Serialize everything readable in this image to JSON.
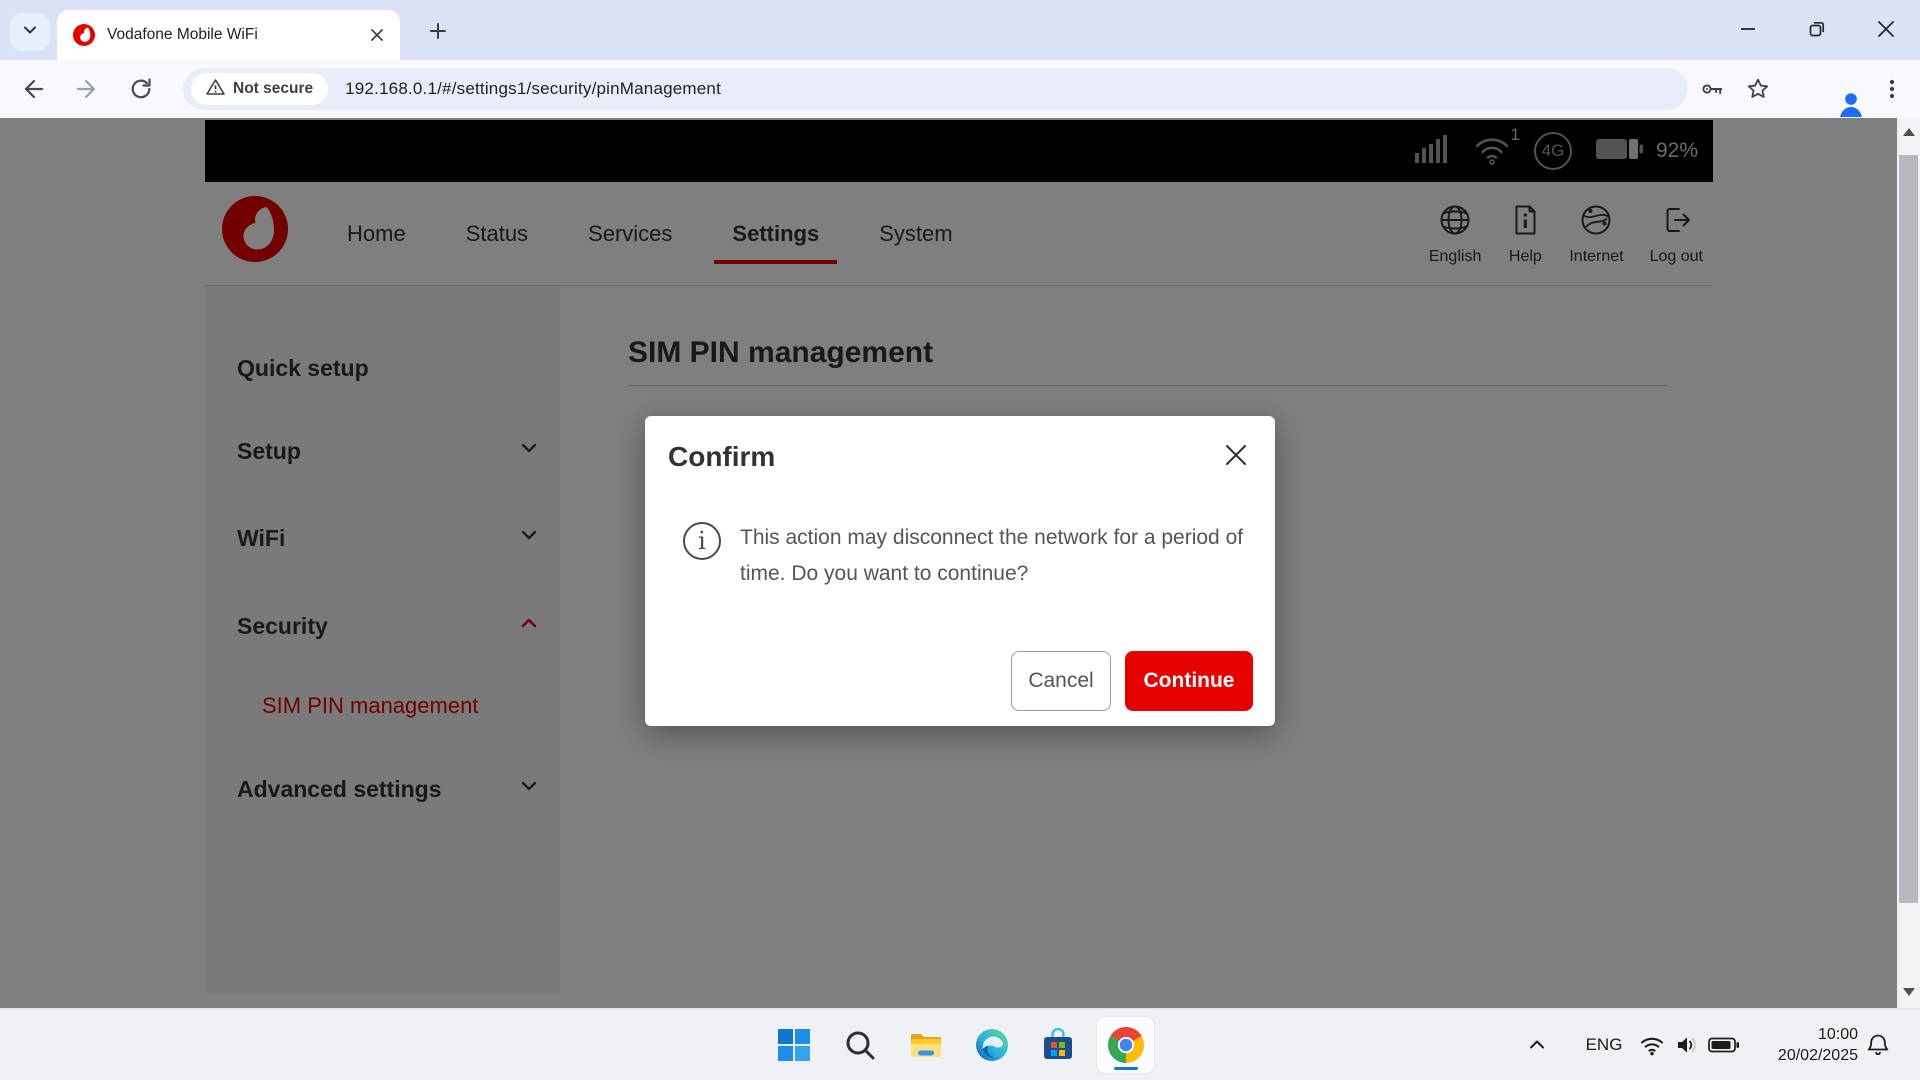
{
  "browser": {
    "tab_title": "Vodafone Mobile WiFi",
    "security_chip": "Not secure",
    "url": "192.168.0.1/#/settings1/security/pinManagement"
  },
  "device_status": {
    "wifi_clients": "1",
    "network_badge": "4G",
    "battery_percent": "92%"
  },
  "nav": {
    "items": [
      {
        "label": "Home"
      },
      {
        "label": "Status"
      },
      {
        "label": "Services"
      },
      {
        "label": "Settings",
        "active": true
      },
      {
        "label": "System"
      }
    ],
    "utilities": [
      {
        "label": "English"
      },
      {
        "label": "Help"
      },
      {
        "label": "Internet"
      },
      {
        "label": "Log out"
      }
    ]
  },
  "sidebar": {
    "items": [
      {
        "label": "Quick setup"
      },
      {
        "label": "Setup",
        "chevron": "down"
      },
      {
        "label": "WiFi",
        "chevron": "down"
      },
      {
        "label": "Security",
        "chevron": "up",
        "expanded": true
      },
      {
        "label": "SIM PIN management",
        "sub": true,
        "active": true
      },
      {
        "label": "Advanced settings",
        "chevron": "down"
      }
    ]
  },
  "main": {
    "title": "SIM PIN management"
  },
  "dialog": {
    "title": "Confirm",
    "message": "This action may disconnect the network for a period of time. Do you want to continue?",
    "cancel_label": "Cancel",
    "continue_label": "Continue"
  },
  "taskbar": {
    "language": "ENG",
    "time": "10:00",
    "date": "20/02/2025"
  },
  "colors": {
    "vodafone_red": "#e60000",
    "dim_overlay": "rgba(0,0,0,0.5)"
  }
}
